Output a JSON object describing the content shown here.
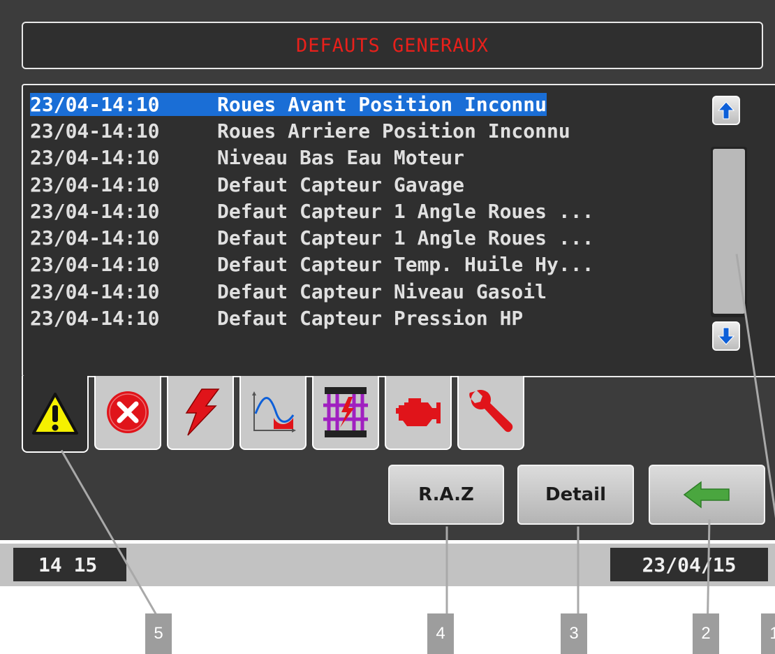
{
  "title": "DEFAUTS GENERAUX",
  "faults": [
    {
      "time": "23/04-14:10",
      "message": "Roues Avant Position Inconnu",
      "selected": true
    },
    {
      "time": "23/04-14:10",
      "message": "Roues Arriere Position Inconnu",
      "selected": false
    },
    {
      "time": "23/04-14:10",
      "message": "Niveau Bas Eau Moteur",
      "selected": false
    },
    {
      "time": "23/04-14:10",
      "message": "Defaut Capteur Gavage",
      "selected": false
    },
    {
      "time": "23/04-14:10",
      "message": "Defaut Capteur 1 Angle Roues ...",
      "selected": false
    },
    {
      "time": "23/04-14:10",
      "message": "Defaut Capteur 1 Angle Roues ...",
      "selected": false
    },
    {
      "time": "23/04-14:10",
      "message": "Defaut Capteur Temp. Huile Hy...",
      "selected": false
    },
    {
      "time": "23/04-14:10",
      "message": "Defaut Capteur Niveau Gasoil",
      "selected": false
    },
    {
      "time": "23/04-14:10",
      "message": "Defaut Capteur Pression HP",
      "selected": false
    }
  ],
  "tabs": [
    {
      "icon": "warning-triangle-icon",
      "active": true
    },
    {
      "icon": "error-cross-icon",
      "active": false
    },
    {
      "icon": "lightning-icon",
      "active": false
    },
    {
      "icon": "level-curve-icon",
      "active": false
    },
    {
      "icon": "electrical-fault-icon",
      "active": false
    },
    {
      "icon": "engine-icon",
      "active": false
    },
    {
      "icon": "wrench-icon",
      "active": false
    }
  ],
  "buttons": {
    "raz": "R.A.Z",
    "detail": "Detail",
    "back": "back-arrow-icon"
  },
  "status": {
    "time": "14 15",
    "date": "23/04/15"
  },
  "callouts": [
    "1",
    "2",
    "3",
    "4",
    "5"
  ],
  "colors": {
    "title": "#e8201b",
    "selection": "#1a6ed6",
    "arrow": "#4aa63f",
    "scroll_arrow": "#0d5fd8",
    "warning": "#f5f000"
  }
}
